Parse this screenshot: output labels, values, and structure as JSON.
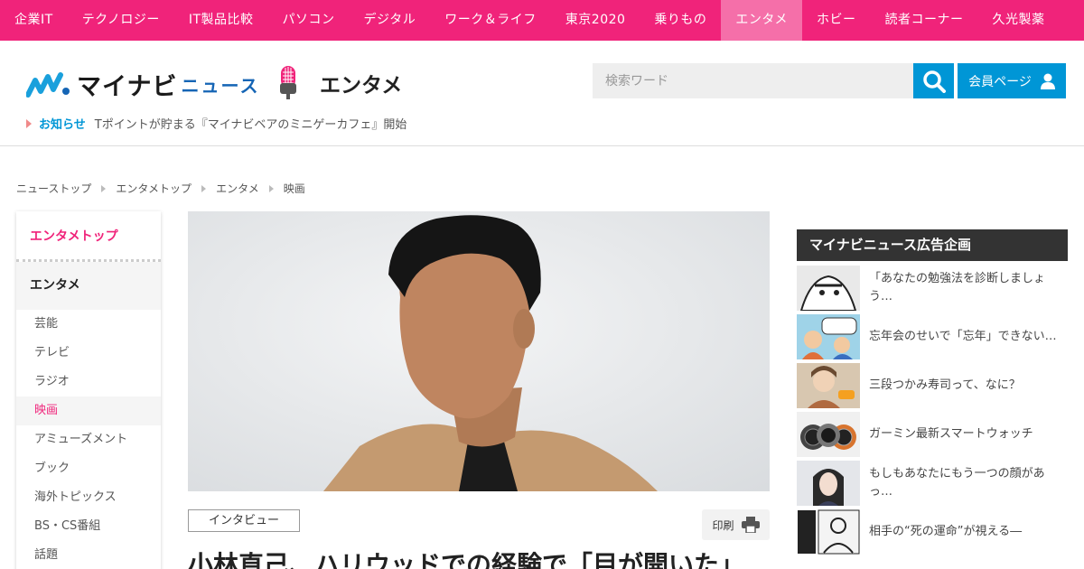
{
  "topnav": {
    "items": [
      "企業IT",
      "テクノロジー",
      "IT製品比較",
      "パソコン",
      "デジタル",
      "ワーク＆ライフ",
      "東京2020",
      "乗りもの",
      "エンタメ",
      "ホビー",
      "読者コーナー",
      "久光製薬"
    ],
    "active_index": 8
  },
  "header": {
    "logo_text": "マイナビ",
    "logo_news": "ニュース",
    "section_title": "エンタメ",
    "search_placeholder": "検索ワード",
    "member_label": "会員ページ"
  },
  "notice": {
    "label": "お知らせ",
    "text": "Tポイントが貯まる『マイナビベアのミニゲーカフェ』開始"
  },
  "breadcrumb": [
    "ニューストップ",
    "エンタメトップ",
    "エンタメ",
    "映画"
  ],
  "sidemenu": {
    "top": "エンタメトップ",
    "category": "エンタメ",
    "items": [
      "芸能",
      "テレビ",
      "ラジオ",
      "映画",
      "アミューズメント",
      "ブック",
      "海外トピックス",
      "BS・CS番組",
      "話題"
    ],
    "active_index": 3
  },
  "article": {
    "tag": "インタビュー",
    "print_label": "印刷",
    "headline": "小林直己、ハリウッドでの経験で「目が開いた」"
  },
  "ad": {
    "title": "マイナビニュース広告企画",
    "items": [
      "「あなたの勉強法を診断しましょう…",
      "忘年会のせいで「忘年」できない…",
      "三段つかみ寿司って、なに？",
      "ガーミン最新スマートウォッチ",
      "もしもあなたにもう一つの顔があっ…",
      "相手の“死の運命”が視える―"
    ]
  },
  "colors": {
    "brand_pink": "#f0237a",
    "accent_blue": "#0096d6"
  }
}
